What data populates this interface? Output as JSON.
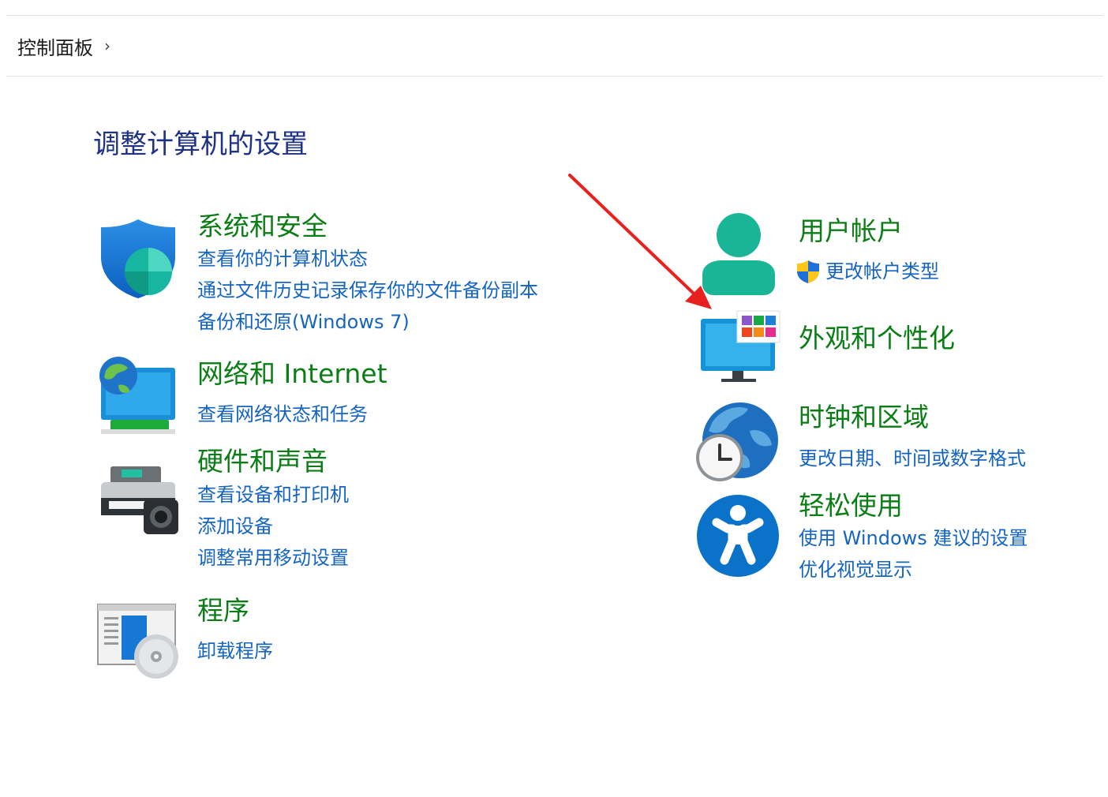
{
  "breadcrumb": {
    "label": "控制面板",
    "separator": "›"
  },
  "title": "调整计算机的设置",
  "categories": {
    "system": {
      "title": "系统和安全",
      "links": [
        "查看你的计算机状态",
        "通过文件历史记录保存你的文件备份副本",
        "备份和还原(Windows 7)"
      ],
      "icon": "shield-icon"
    },
    "network": {
      "title": "网络和 Internet",
      "links": [
        "查看网络状态和任务"
      ],
      "icon": "network-globe-icon"
    },
    "hardware": {
      "title": "硬件和声音",
      "links": [
        "查看设备和打印机",
        "添加设备",
        "调整常用移动设置"
      ],
      "icon": "printer-icon"
    },
    "programs": {
      "title": "程序",
      "links": [
        "卸载程序"
      ],
      "icon": "programs-disc-icon"
    },
    "users": {
      "title": "用户帐户",
      "links": [
        "更改帐户类型"
      ],
      "icon": "user-icon"
    },
    "appearance": {
      "title": "外观和个性化",
      "links": [],
      "icon": "monitor-palette-icon"
    },
    "clock": {
      "title": "时钟和区域",
      "links": [
        "更改日期、时间或数字格式"
      ],
      "icon": "globe-clock-icon"
    },
    "ease": {
      "title": "轻松使用",
      "links": [
        "使用 Windows 建议的设置",
        "优化视觉显示"
      ],
      "icon": "accessibility-icon"
    }
  },
  "colors": {
    "title": "#1e3287",
    "category": "#0a7d15",
    "link": "#1565c0",
    "annotation_arrow": "#e8211f"
  }
}
